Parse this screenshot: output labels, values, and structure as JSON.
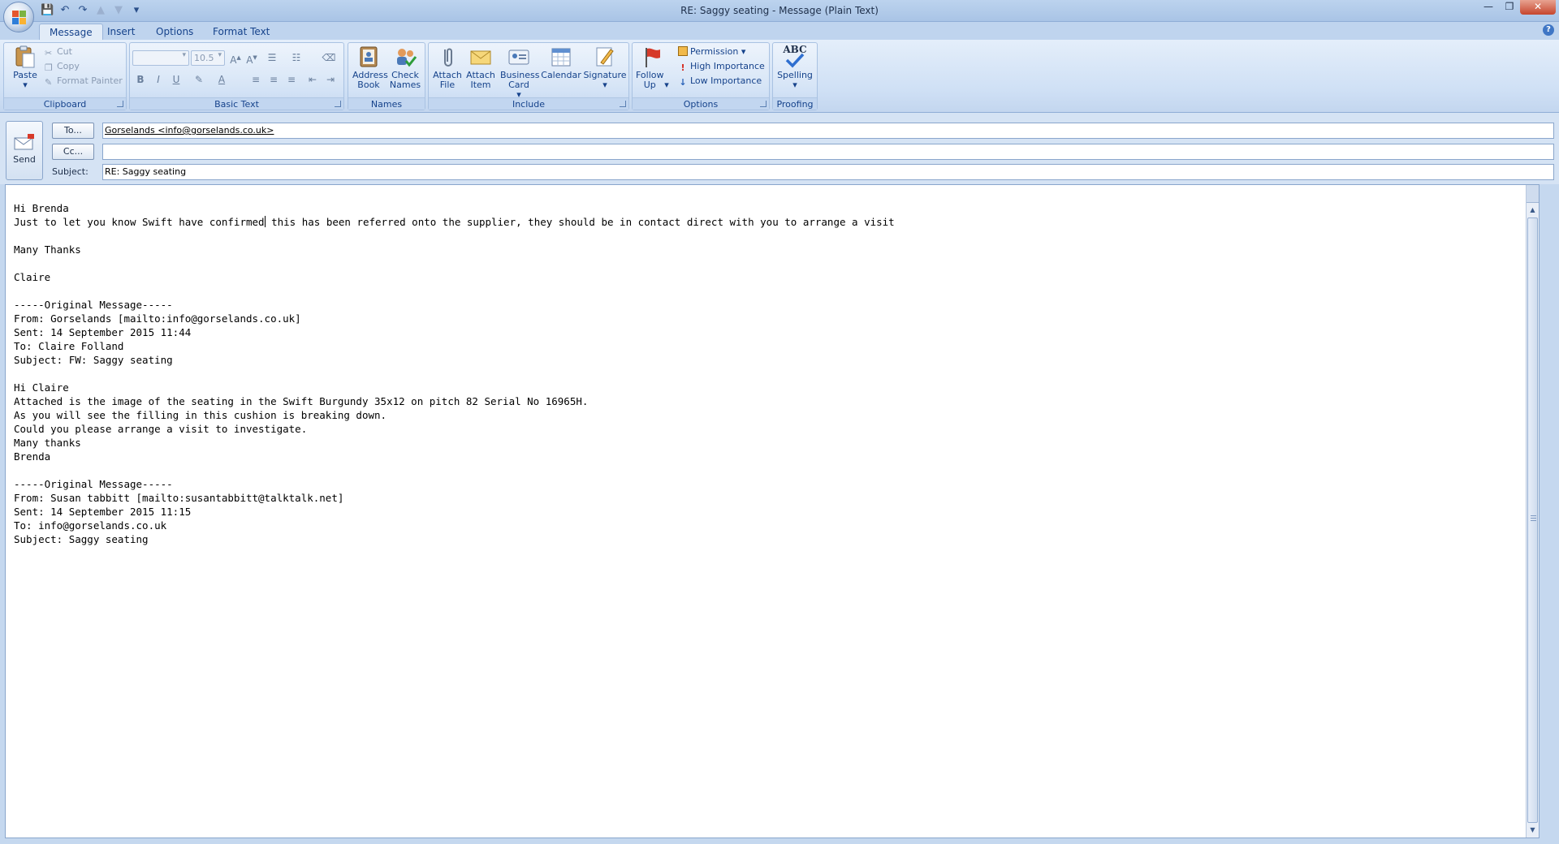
{
  "window": {
    "title": "RE: Saggy seating - Message (Plain Text)",
    "min": "—",
    "max": "❐",
    "close": "✕"
  },
  "qat": [
    "💾",
    "↶",
    "↷",
    "▲",
    "▼",
    "▾"
  ],
  "tabs": [
    "Message",
    "Insert",
    "Options",
    "Format Text"
  ],
  "ribbon": {
    "clipboard": {
      "paste": "Paste",
      "cut": "Cut",
      "copy": "Copy",
      "format_painter": "Format Painter",
      "label": "Clipboard"
    },
    "basic_text": {
      "font_size": "10.5",
      "bold": "B",
      "italic": "I",
      "underline": "U",
      "label": "Basic Text"
    },
    "names": {
      "address_book": "Address Book",
      "check_names": "Check Names",
      "label": "Names"
    },
    "include": {
      "attach_file": "Attach File",
      "attach_item": "Attach Item",
      "business_card": "Business Card",
      "calendar": "Calendar",
      "signature": "Signature",
      "label": "Include"
    },
    "options": {
      "follow_up": "Follow Up",
      "permission": "Permission",
      "high_importance": "High Importance",
      "low_importance": "Low Importance",
      "label": "Options"
    },
    "proofing": {
      "spelling_logo": "ABC",
      "spelling": "Spelling",
      "label": "Proofing"
    }
  },
  "header": {
    "send": "Send",
    "to_button": "To...",
    "cc_button": "Cc...",
    "subject_label": "Subject:",
    "to_value": "Gorselands <info@gorselands.co.uk>",
    "cc_value": "",
    "subject_value": "RE: Saggy seating"
  },
  "body": {
    "line1": "Hi Brenda",
    "line2a": "Just to let you know Swift have confirmed",
    "line2b": " this has been referred onto the supplier, they should be in contact direct with you to arrange a visit",
    "rest": "\nMany Thanks\n\nClaire\n\n-----Original Message-----\nFrom: Gorselands [mailto:info@gorselands.co.uk]\nSent: 14 September 2015 11:44\nTo: Claire Folland\nSubject: FW: Saggy seating\n\nHi Claire\nAttached is the image of the seating in the Swift Burgundy 35x12 on pitch 82 Serial No 16965H.\nAs you will see the filling in this cushion is breaking down.\nCould you please arrange a visit to investigate.\nMany thanks\nBrenda\n\n-----Original Message-----\nFrom: Susan tabbitt [mailto:susantabbitt@talktalk.net]\nSent: 14 September 2015 11:15\nTo: info@gorselands.co.uk\nSubject: Saggy seating"
  }
}
